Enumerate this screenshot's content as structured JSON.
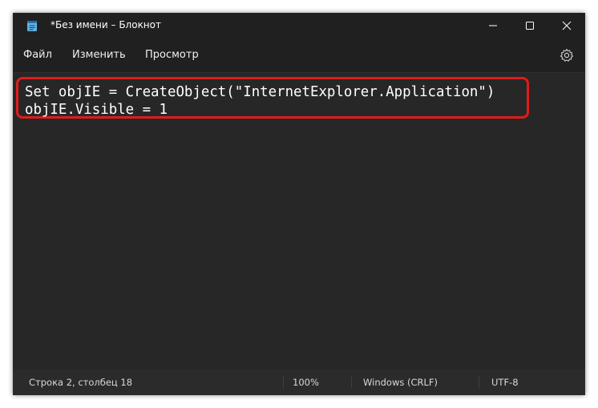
{
  "window": {
    "title": "*Без имени – Блокнот"
  },
  "icons": {
    "app": "notepad-icon",
    "minimize": "minimize-icon",
    "maximize": "maximize-icon",
    "close": "close-icon",
    "settings": "gear-icon"
  },
  "menu": {
    "file": "Файл",
    "edit": "Изменить",
    "view": "Просмотр"
  },
  "editor": {
    "lines": [
      "Set objIE = CreateObject(\"InternetExplorer.Application\")",
      "objIE.Visible = 1"
    ]
  },
  "status": {
    "position": "Строка 2, столбец 18",
    "zoom": "100%",
    "line_ending": "Windows (CRLF)",
    "encoding": "UTF-8"
  },
  "colors": {
    "highlight": "#e11b1b",
    "background": "#202020",
    "editor_bg": "#272727"
  }
}
